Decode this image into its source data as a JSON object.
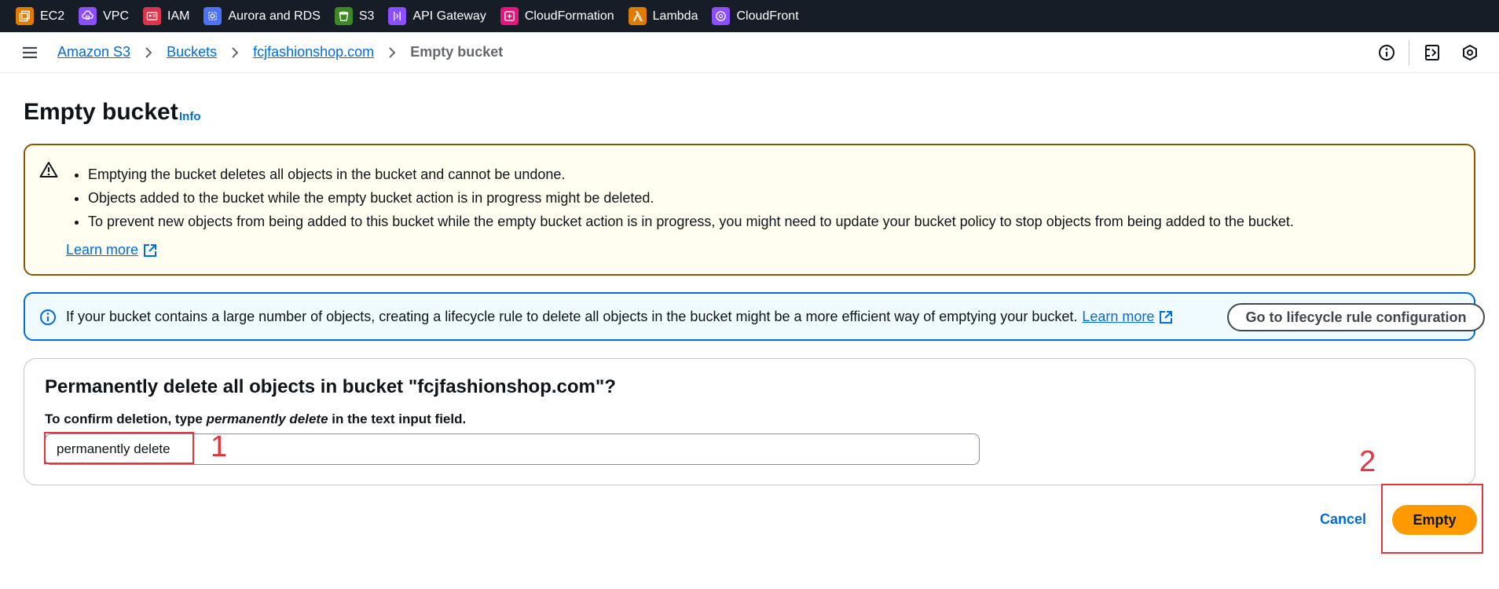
{
  "services": [
    {
      "label": "EC2",
      "icon": "ec2-icon",
      "color": "#e07b00"
    },
    {
      "label": "VPC",
      "icon": "vpc-icon",
      "color": "#8c4fff"
    },
    {
      "label": "IAM",
      "icon": "iam-icon",
      "color": "#dd344c"
    },
    {
      "label": "Aurora and RDS",
      "icon": "rds-icon",
      "color": "#4d72f3"
    },
    {
      "label": "S3",
      "icon": "s3-icon",
      "color": "#3f8624"
    },
    {
      "label": "API Gateway",
      "icon": "api-gateway-icon",
      "color": "#8c4fff"
    },
    {
      "label": "CloudFormation",
      "icon": "cloudformation-icon",
      "color": "#e7157b"
    },
    {
      "label": "Lambda",
      "icon": "lambda-icon",
      "color": "#e07b00"
    },
    {
      "label": "CloudFront",
      "icon": "cloudfront-icon",
      "color": "#8c4fff"
    }
  ],
  "breadcrumb": {
    "items": [
      "Amazon S3",
      "Buckets",
      "fcjfashionshop.com"
    ],
    "current": "Empty bucket"
  },
  "header": {
    "title": "Empty bucket",
    "info_link": "Info"
  },
  "warning": {
    "bullets": [
      "Emptying the bucket deletes all objects in the bucket and cannot be undone.",
      "Objects added to the bucket while the empty bucket action is in progress might be deleted.",
      "To prevent new objects from being added to this bucket while the empty bucket action is in progress, you might need to update your bucket policy to stop objects from being added to the bucket."
    ],
    "learn_more": "Learn more"
  },
  "info_alert": {
    "text": "If your bucket contains a large number of objects, creating a lifecycle rule to delete all objects in the bucket might be a more efficient way of emptying your bucket.",
    "learn_more": "Learn more",
    "button": "Go to lifecycle rule configuration"
  },
  "confirm": {
    "heading": "Permanently delete all objects in bucket \"fcjfashionshop.com\"?",
    "label_pre": "To confirm deletion, type ",
    "label_em": "permanently delete",
    "label_post": " in the text input field.",
    "input_value": "permanently delete"
  },
  "annotations": {
    "step1": "1",
    "step2": "2"
  },
  "actions": {
    "cancel": "Cancel",
    "empty": "Empty"
  }
}
